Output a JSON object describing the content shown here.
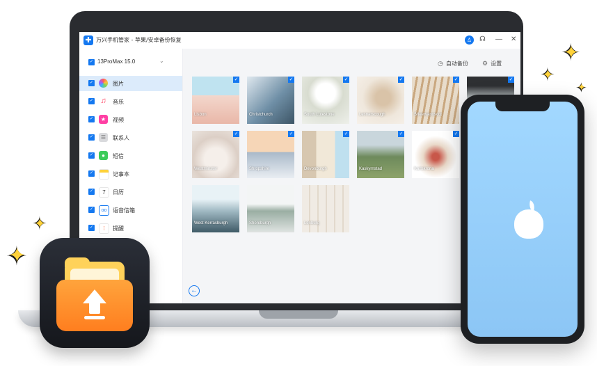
{
  "window": {
    "title": "万兴手机管家 - 苹果/安卓备份恢复"
  },
  "titlebar_icons": [
    "user-avatar-icon",
    "headset-icon",
    "minimize-icon",
    "close-icon"
  ],
  "toolbar": {
    "backup_label": "自动备份",
    "settings_label": "设置"
  },
  "sidebar": {
    "device": "13ProMax 15.0",
    "items": [
      {
        "label": "图片",
        "icon": "photos-icon",
        "active": true
      },
      {
        "label": "音乐",
        "icon": "music-icon"
      },
      {
        "label": "视频",
        "icon": "video-icon"
      },
      {
        "label": "联系人",
        "icon": "contacts-icon"
      },
      {
        "label": "短信",
        "icon": "messages-icon"
      },
      {
        "label": "记事本",
        "icon": "notes-icon"
      },
      {
        "label": "日历",
        "icon": "calendar-icon",
        "icon_text": "7"
      },
      {
        "label": "语音信箱",
        "icon": "voicemail-icon"
      },
      {
        "label": "提醒",
        "icon": "reminders-icon"
      }
    ]
  },
  "photos": [
    {
      "caption": "Lisbon",
      "checked": true
    },
    {
      "caption": "Christchurch",
      "checked": true
    },
    {
      "caption": "South Lutestone",
      "checked": true
    },
    {
      "caption": "Lesnarscough",
      "checked": true
    },
    {
      "caption": "Sheervanoscot",
      "checked": true
    },
    {
      "caption": "",
      "checked": true
    },
    {
      "caption": "Westminster",
      "checked": true
    },
    {
      "caption": "Shropshire",
      "checked": true
    },
    {
      "caption": "Devonburgh",
      "checked": true
    },
    {
      "caption": "Kaskyrnstad",
      "checked": true
    },
    {
      "caption": "Karlskrona",
      "checked": true
    },
    {
      "caption": "West Kerrasburgh",
      "checked": false
    },
    {
      "caption": "Shoreburgh",
      "checked": false
    },
    {
      "caption": "Lenburg",
      "checked": false
    }
  ],
  "colors": {
    "accent": "#1478f0",
    "active_row": "#dcebfb"
  }
}
